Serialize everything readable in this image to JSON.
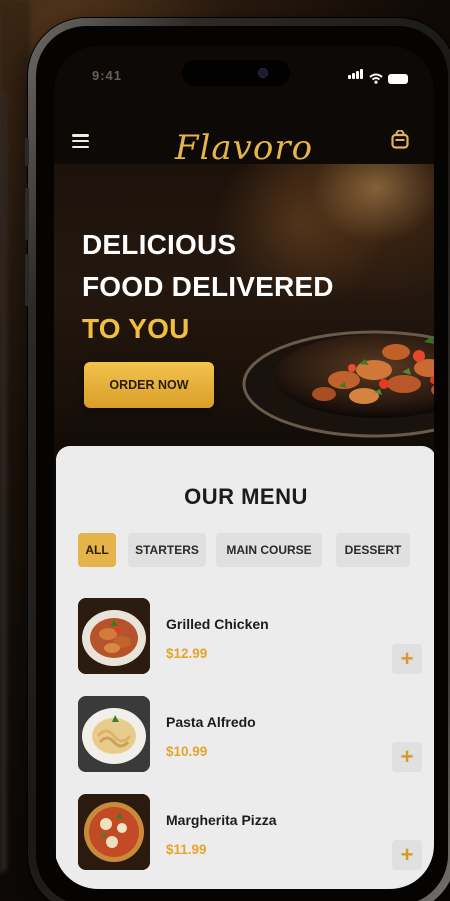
{
  "status_bar": {
    "time": "9:41"
  },
  "header": {
    "logo": "Flavoro"
  },
  "hero": {
    "line1": "DELICIOUS",
    "line2": "FOOD DELIVERED",
    "line3": "TO YOU",
    "cta": "ORDER NOW"
  },
  "menu": {
    "title": "OUR MENU",
    "tabs": [
      {
        "label": "ALL",
        "active": true
      },
      {
        "label": "STARTERS",
        "active": false
      },
      {
        "label": "MAIN COURSE",
        "active": false
      },
      {
        "label": "DESSERT",
        "active": false
      }
    ],
    "items": [
      {
        "name": "Grilled Chicken",
        "price": "$12.99",
        "add": "+"
      },
      {
        "name": "Pasta Alfredo",
        "price": "$10.99",
        "add": "+"
      },
      {
        "name": "Margherita Pizza",
        "price": "$11.99",
        "add": "+"
      }
    ]
  },
  "colors": {
    "accent_gold": "#e4b54a",
    "button_gold": "#f2c34e",
    "price_orange": "#e2a52d",
    "card_bg": "#ececec",
    "screen_bg": "#0d0907"
  },
  "icons": [
    "hamburger-menu-icon",
    "cart-icon",
    "signal-icon",
    "wifi-icon",
    "battery-icon",
    "plus-icon"
  ]
}
